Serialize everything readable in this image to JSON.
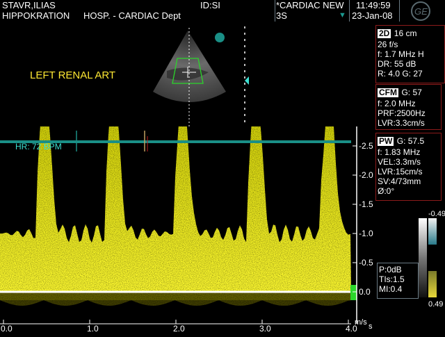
{
  "header": {
    "patient_name": "STAVR,ILIAS",
    "hospital": "HIPPOKRATION",
    "department": "HOSP. - CARDIAC Dept",
    "id": "ID:SI",
    "exam": "*CARDIAC NEW",
    "probe": "3S",
    "time": "11:49:59",
    "date": "23-Jan-08"
  },
  "image_label": "LEFT RENAL ART",
  "heart_rate": "HR: 72 BPM",
  "panels": {
    "twod": {
      "title": "2D",
      "depth": "16 cm",
      "rows": [
        "26 f/s",
        "f: 1.7 MHz H",
        "DR: 55 dB",
        "R: 4.0   G: 27"
      ]
    },
    "cfm": {
      "title": "CFM",
      "gain": "G: 57",
      "rows": [
        "f: 2.0 MHz",
        "PRF:2500Hz",
        "LVR:3.3cm/s"
      ]
    },
    "pw": {
      "title": "PW",
      "gain": "G: 57.5",
      "rows": [
        "f: 1.83 MHz",
        "VEL:3.3m/s",
        "LVR:15cm/s",
        "SV:4/73mm",
        "Ø:0°"
      ]
    },
    "power": {
      "rows": [
        "P:0dB",
        "TIs:1.5",
        "MI:0.4"
      ]
    }
  },
  "color_scale": {
    "top": "-0.49",
    "bottom": "0.49"
  },
  "doppler_axis": {
    "unit": "m/s",
    "y_ticks": [
      "-2.5",
      "-2.0",
      "-1.5",
      "-1.0",
      "-0.5",
      "0.0"
    ],
    "x_ticks": [
      "0.0",
      "1.0",
      "2.0",
      "3.0",
      "4.0"
    ],
    "x_unit": "s"
  },
  "colors": {
    "spectrum": "#e6e600",
    "ecg": "#1a8f86",
    "panel_border": "#8d1b1b",
    "label": "#ffe833"
  }
}
